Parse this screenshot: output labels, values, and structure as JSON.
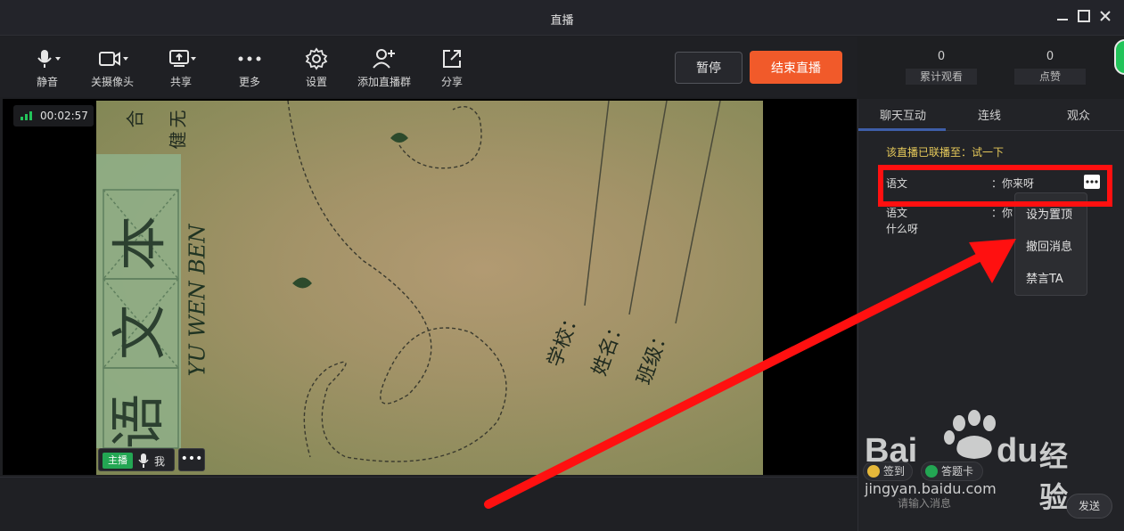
{
  "window": {
    "title": "直播"
  },
  "toolbar": {
    "items": [
      {
        "label": "静音",
        "icon": "microphone-icon"
      },
      {
        "label": "关摄像头",
        "icon": "camera-icon"
      },
      {
        "label": "共享",
        "icon": "screen-share-icon"
      },
      {
        "label": "更多",
        "icon": "more-icon"
      },
      {
        "label": "设置",
        "icon": "gear-icon"
      },
      {
        "label": "添加直播群",
        "icon": "add-group-icon"
      },
      {
        "label": "分享",
        "icon": "share-icon"
      }
    ],
    "pause_label": "暂停",
    "end_label": "结束直播"
  },
  "stats": {
    "views_count": "0",
    "views_label": "累计观看",
    "likes_count": "0",
    "likes_label": "点赞"
  },
  "video": {
    "timer": "00:02:57",
    "host_tag": "主播",
    "host_name": "我",
    "more": "•••",
    "cover": {
      "title_chars": [
        "语",
        "文",
        "本"
      ],
      "pinyin": "YU WEN BEN",
      "corner_chars_1": "合",
      "corner_chars_2": "无",
      "corner_chars_3": "健",
      "field_school": "学校：",
      "field_name": "姓名：",
      "field_class": "班级："
    }
  },
  "panel": {
    "tabs": [
      "聊天互动",
      "连线",
      "观众"
    ],
    "notice": "该直播已联播至：试一下",
    "messages": [
      {
        "sender": "语文",
        "text": "你来呀"
      },
      {
        "sender": "语文",
        "text": "你",
        "continuation": "什么呀"
      }
    ],
    "context_menu": [
      "设为置顶",
      "撤回消息",
      "禁言TA"
    ],
    "chips": [
      "签到",
      "答题卡"
    ],
    "input_placeholder": "请输入消息",
    "send_label": "发送"
  },
  "watermark": {
    "brand": "Bai",
    "brand2": "du",
    "cn": "经验",
    "url": "jingyan.baidu.com"
  },
  "colors": {
    "accent_end": "#f15a2a",
    "highlight": "#ff1010",
    "notice": "#e6c95a",
    "host_green": "#23a653"
  }
}
